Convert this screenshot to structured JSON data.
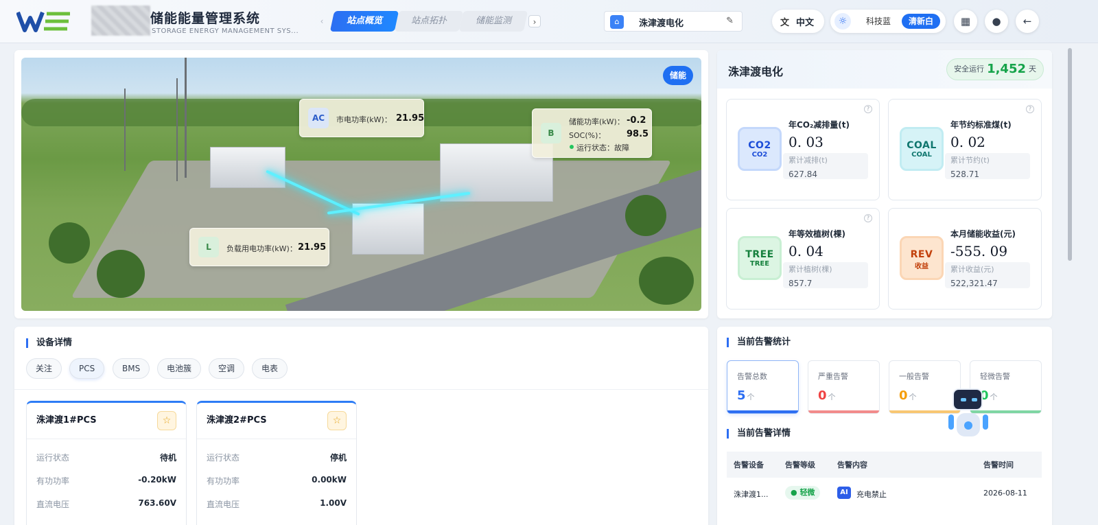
{
  "header": {
    "system_title": "储能能量管理系统",
    "system_subtitle": "STORAGE ENERGY MANAGEMENT SYS...",
    "tabs": [
      {
        "label": "站点概览",
        "active": true
      },
      {
        "label": "站点拓扑",
        "active": false
      },
      {
        "label": "储能监测",
        "active": false
      }
    ],
    "prev_arrow": "‹",
    "next_arrow": "›",
    "site_name": "洙津渡电化",
    "language": "中文",
    "theme_options": [
      "科技蓝",
      "清新白"
    ],
    "active_theme": "清新白"
  },
  "scene": {
    "badge": "储能",
    "grid_card": {
      "tag": "AC",
      "label": "市电功率(kW)：",
      "value": "21.95"
    },
    "storage_card": {
      "tag": "B",
      "power_label": "储能功率(kW)：",
      "power_value": "-0.2",
      "soc_label": "SOC(%)：",
      "soc_value": "98.5",
      "status_label": "运行状态：故障"
    },
    "load_card": {
      "tag": "L",
      "label": "负载用电功率(kW)：",
      "value": "21.95"
    }
  },
  "site_summary": {
    "title": "洙津渡电化",
    "safe_label": "安全运行",
    "safe_days": "1,452",
    "safe_unit": "天",
    "stats": [
      {
        "icon_main": "CO2",
        "icon_sub": "CO2",
        "title": "年CO₂减排量(t)",
        "value": "0. 03",
        "sub_label": "累计减排(t)",
        "sub_value": "627.84",
        "color": "#1d4ed8",
        "bg": "#dbe8fd"
      },
      {
        "icon_main": "COAL",
        "icon_sub": "COAL",
        "title": "年节约标准煤(t)",
        "value": "0. 02",
        "sub_label": "累计节约(t)",
        "sub_value": "528.71",
        "color": "#0f766e",
        "bg": "#d6f3f7"
      },
      {
        "icon_main": "TREE",
        "icon_sub": "TREE",
        "title": "年等效植树(棵)",
        "value": "0. 04",
        "sub_label": "累计植树(棵)",
        "sub_value": "857.7",
        "color": "#15803d",
        "bg": "#dcf5e3"
      },
      {
        "icon_main": "REV",
        "icon_sub": "收益",
        "title": "本月储能收益(元)",
        "value": "-555. 09",
        "sub_label": "累计收益(元)",
        "sub_value": "522,321.47",
        "color": "#c2410c",
        "bg": "#fde5cf"
      }
    ]
  },
  "devices": {
    "section_title": "设备详情",
    "filters": [
      "关注",
      "PCS",
      "BMS",
      "电池簇",
      "空调",
      "电表"
    ],
    "active_filter": "PCS",
    "cards": [
      {
        "name": "洙津渡1#PCS",
        "rows": [
          {
            "label": "运行状态",
            "value": "待机"
          },
          {
            "label": "有功功率",
            "value": "-0.20kW"
          },
          {
            "label": "直流电压",
            "value": "763.60V"
          }
        ]
      },
      {
        "name": "洙津渡2#PCS",
        "rows": [
          {
            "label": "运行状态",
            "value": "停机"
          },
          {
            "label": "有功功率",
            "value": "0.00kW"
          },
          {
            "label": "直流电压",
            "value": "1.00V"
          }
        ]
      }
    ]
  },
  "alarms": {
    "stats_title": "当前告警统计",
    "cards": [
      {
        "label": "告警总数",
        "value": "5",
        "unit": "个",
        "color": "#2d6ef2"
      },
      {
        "label": "严重告警",
        "value": "0",
        "unit": "个",
        "color": "#ef4444"
      },
      {
        "label": "一般告警",
        "value": "0",
        "unit": "个",
        "color": "#f59e0b"
      },
      {
        "label": "轻微告警",
        "value": "0",
        "unit": "个",
        "color": "#22c55e"
      }
    ],
    "details_title": "当前告警详情",
    "columns": [
      "告警设备",
      "告警等级",
      "告警内容",
      "告警时间"
    ],
    "rows": [
      {
        "device": "洙津渡1...",
        "level": "轻微",
        "ai": "AI",
        "content": "充电禁止",
        "time": "2026-08-11"
      }
    ]
  }
}
